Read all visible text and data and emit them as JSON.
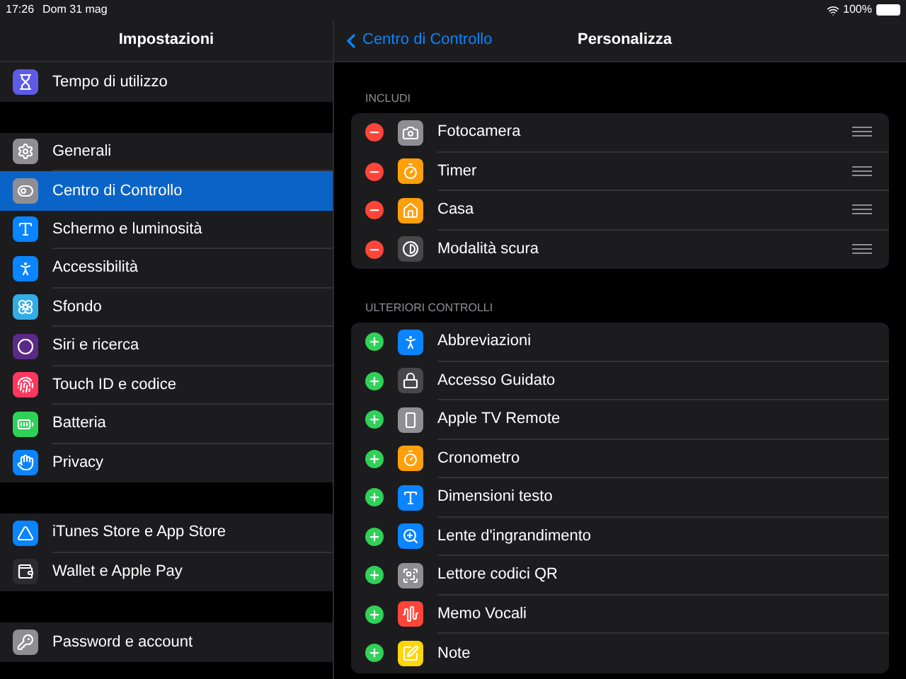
{
  "status_bar": {
    "time": "17:26",
    "date": "Dom 31 mag",
    "battery": "100%"
  },
  "sidebar": {
    "title": "Impostazioni",
    "groups": [
      {
        "items": [
          {
            "label": "Tempo di utilizzo",
            "selected": false,
            "color": "#5e5ce6"
          }
        ]
      },
      {
        "items": [
          {
            "label": "Generali",
            "selected": false,
            "color": "#8e8e93"
          },
          {
            "label": "Centro di Controllo",
            "selected": true,
            "color": "#8e8e93"
          },
          {
            "label": "Schermo e luminosità",
            "selected": false,
            "color": "#0a84ff"
          },
          {
            "label": "Accessibilità",
            "selected": false,
            "color": "#0a84ff"
          },
          {
            "label": "Sfondo",
            "selected": false,
            "color": "#32ade6"
          },
          {
            "label": "Siri e ricerca",
            "selected": false,
            "color": "#5b2a86"
          },
          {
            "label": "Touch ID e codice",
            "selected": false,
            "color": "#ff375f"
          },
          {
            "label": "Batteria",
            "selected": false,
            "color": "#30d158"
          },
          {
            "label": "Privacy",
            "selected": false,
            "color": "#0a84ff"
          }
        ]
      },
      {
        "items": [
          {
            "label": "iTunes Store e App Store",
            "selected": false,
            "color": "#0a84ff"
          },
          {
            "label": "Wallet e Apple Pay",
            "selected": false,
            "color": "#2c2c2e"
          }
        ]
      },
      {
        "items": [
          {
            "label": "Password e account",
            "selected": false,
            "color": "#8e8e93"
          }
        ]
      }
    ]
  },
  "detail": {
    "back": "Centro di Controllo",
    "title": "Personalizza",
    "sections": [
      {
        "header": "INCLUDI",
        "kind": "included",
        "items": [
          {
            "label": "Fotocamera",
            "color": "#8e8e93"
          },
          {
            "label": "Timer",
            "color": "#ff9f0a"
          },
          {
            "label": "Casa",
            "color": "#ff9f0a"
          },
          {
            "label": "Modalità scura",
            "color": "#48484a"
          }
        ]
      },
      {
        "header": "ULTERIORI CONTROLLI",
        "kind": "available",
        "items": [
          {
            "label": "Abbreviazioni",
            "color": "#0a84ff"
          },
          {
            "label": "Accesso Guidato",
            "color": "#48484a"
          },
          {
            "label": "Apple TV Remote",
            "color": "#8e8e93"
          },
          {
            "label": "Cronometro",
            "color": "#ff9f0a"
          },
          {
            "label": "Dimensioni testo",
            "color": "#0a84ff"
          },
          {
            "label": "Lente d'ingrandimento",
            "color": "#0a84ff"
          },
          {
            "label": "Lettore codici QR",
            "color": "#8e8e93"
          },
          {
            "label": "Memo Vocali",
            "color": "#ff453a"
          },
          {
            "label": "Note",
            "color": "#ffd60a"
          }
        ]
      }
    ]
  }
}
